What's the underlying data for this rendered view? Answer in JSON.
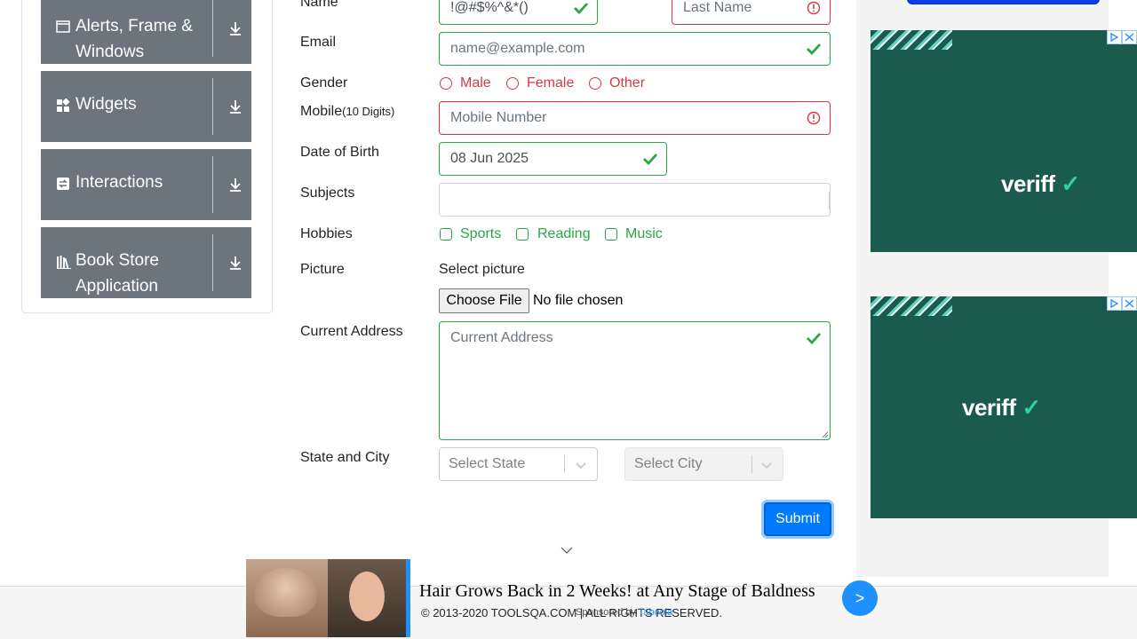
{
  "sidebar": {
    "groups": [
      {
        "label_line1": "Alerts, Frame &",
        "label_line2": "Windows",
        "icon": "window-icon"
      },
      {
        "label": "Widgets",
        "icon": "widgets-icon"
      },
      {
        "label": "Interactions",
        "icon": "interactions-icon"
      },
      {
        "label_line1": "Book Store",
        "label_line2": "Application",
        "icon": "book-icon"
      }
    ]
  },
  "form": {
    "name_label": "Name",
    "first_name_value": "!@#$%^&*()",
    "last_name_placeholder": "Last Name",
    "email_label": "Email",
    "email_placeholder": "name@example.com",
    "gender_label": "Gender",
    "gender_options": [
      "Male",
      "Female",
      "Other"
    ],
    "mobile_label": "Mobile",
    "mobile_hint": "(10 Digits)",
    "mobile_placeholder": "Mobile Number",
    "dob_label": "Date of Birth",
    "dob_value": "08 Jun 2025",
    "subjects_label": "Subjects",
    "hobbies_label": "Hobbies",
    "hobbies_options": [
      "Sports",
      "Reading",
      "Music"
    ],
    "picture_label": "Picture",
    "select_picture_text": "Select picture",
    "choose_file_label": "Choose File",
    "no_file_text": "No file chosen",
    "address_label": "Current Address",
    "address_placeholder": "Current Address",
    "state_city_label": "State and City",
    "state_placeholder": "Select State",
    "city_placeholder": "Select City",
    "submit_label": "Submit"
  },
  "ads": {
    "brand": "veriff"
  },
  "footer": {
    "copyright": "© 2013-2020 TOOLSQA.COM | ALL RIGHTS RESERVED.",
    "banner_title": "Hair Grows Back in 2 Weeks! at Any Stage of Baldness",
    "banner_next": ">",
    "sponsored_prefix": "Sponsored by",
    "sponsored_brand": "Taboola"
  },
  "colors": {
    "valid": "#28a745",
    "invalid": "#dc3545",
    "primary": "#007bff",
    "sidebar_group": "#6c757d"
  }
}
